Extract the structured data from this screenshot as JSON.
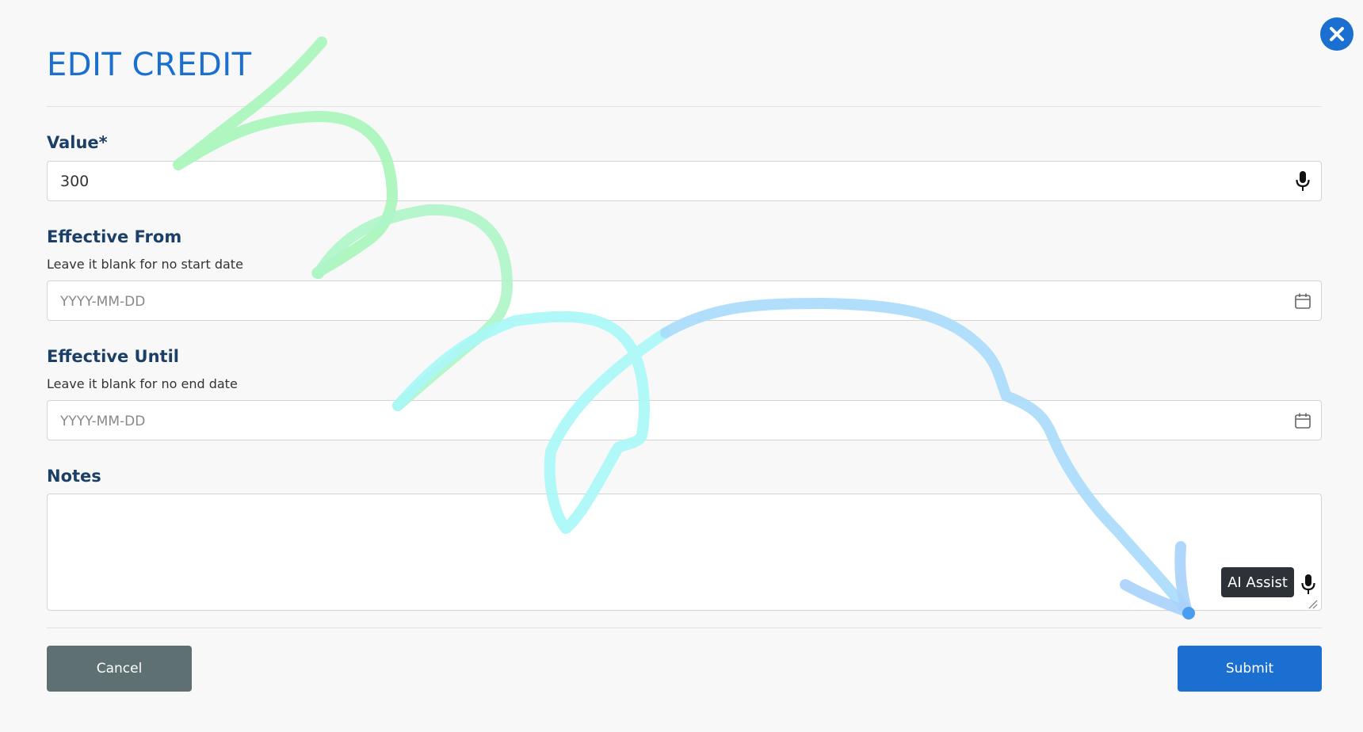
{
  "modal": {
    "title": "EDIT CREDIT",
    "close_icon": "close-icon"
  },
  "value_field": {
    "label": "Value*",
    "value": "300",
    "icon": "microphone-icon"
  },
  "effective_from": {
    "label": "Effective From",
    "hint": "Leave it blank for no start date",
    "placeholder": "YYYY-MM-DD",
    "icon": "calendar-icon"
  },
  "effective_until": {
    "label": "Effective Until",
    "hint": "Leave it blank for no end date",
    "placeholder": "YYYY-MM-DD",
    "icon": "calendar-icon"
  },
  "notes": {
    "label": "Notes",
    "value": "",
    "ai_assist_label": "AI Assist",
    "icon": "microphone-icon"
  },
  "actions": {
    "cancel_label": "Cancel",
    "submit_label": "Submit"
  },
  "colors": {
    "primary": "#1a6fd1",
    "cancel": "#5f7072",
    "label": "#1b3f66",
    "stroke_green": "#a6f5b9",
    "stroke_cyan": "#a8f7f7",
    "stroke_blue": "#a9dcfb",
    "cursor_dot": "#4a9cf0"
  }
}
